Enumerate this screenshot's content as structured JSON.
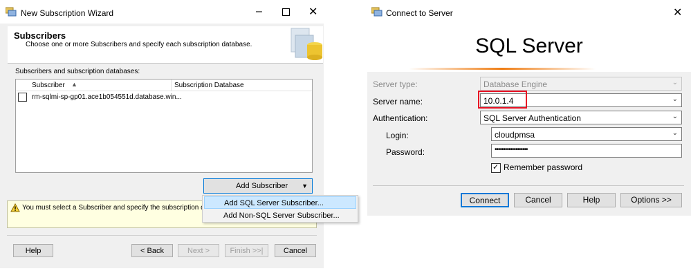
{
  "wizard": {
    "title": "New Subscription Wizard",
    "header_title": "Subscribers",
    "header_desc": "Choose one or more Subscribers and specify each subscription database.",
    "section_label": "Subscribers and subscription databases:",
    "columns": [
      "Subscriber",
      "Subscription Database"
    ],
    "rows": [
      {
        "subscriber": "rm-sqlmi-sp-gp01.ace1b054551d.database.win...",
        "database": ""
      }
    ],
    "add_subscriber": "Add Subscriber",
    "menu_items": [
      "Add SQL Server Subscriber...",
      "Add Non-SQL Server Subscriber..."
    ],
    "warning": "You must select a Subscriber and specify the subscription databas",
    "buttons": {
      "help": "Help",
      "back": "< Back",
      "next": "Next >",
      "finish": "Finish >>|",
      "cancel": "Cancel"
    }
  },
  "connect": {
    "title": "Connect to Server",
    "product": "SQL Server",
    "labels": {
      "server_type": "Server type:",
      "server_name": "Server name:",
      "authentication": "Authentication:",
      "login": "Login:",
      "password": "Password:"
    },
    "values": {
      "server_type": "Database Engine",
      "server_name": "10.0.1.4",
      "authentication": "SQL Server Authentication",
      "login": "cloudpmsa",
      "password": "•••••••••••••••••••"
    },
    "remember": "Remember password",
    "remember_checked": true,
    "buttons": {
      "connect": "Connect",
      "cancel": "Cancel",
      "help": "Help",
      "options": "Options >>"
    },
    "highlight_color": "#e81123"
  }
}
